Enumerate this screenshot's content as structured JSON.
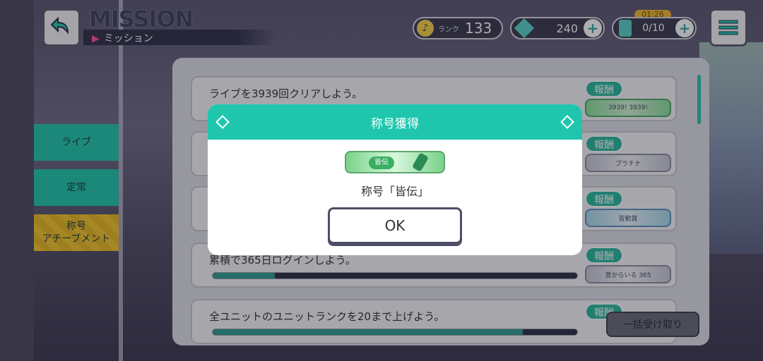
{
  "header": {
    "title": "MISSION",
    "subtitle": "ミッション",
    "rank_label": "ランク",
    "rank_value": "133",
    "gems": "240",
    "stamina": "0/10",
    "timer": "01:26"
  },
  "tabs": [
    {
      "label": "ライブ"
    },
    {
      "label": "定常"
    },
    {
      "label": "称号\nアチーブメント"
    }
  ],
  "missions": [
    {
      "text": "ライブを3939回クリアしよう。",
      "reward_tag": "報酬",
      "reward_item": "3939!  3939!"
    },
    {
      "text": "",
      "reward_tag": "報酬",
      "reward_item": "プラチナ"
    },
    {
      "text": "",
      "reward_tag": "報酬",
      "reward_item": "皆勤賞"
    },
    {
      "text": "累積で365日ログインしよう。",
      "reward_tag": "報酬",
      "reward_item": "昔からいる 365",
      "progress": 0.17
    },
    {
      "text": "全ユニットのユニットランクを20まで上げよう。",
      "reward_tag": "報酬",
      "reward_item": "",
      "progress": 0.85
    }
  ],
  "claim_all_label": "一括受け取り",
  "dialog": {
    "title": "称号獲得",
    "badge_text": "皆伝",
    "title_name": "称号「皆伝」",
    "ok_label": "OK"
  },
  "colors": {
    "accent": "#1fc6ad",
    "tab_active": "#f4c52c",
    "bar_fill": "#2f9b91"
  }
}
